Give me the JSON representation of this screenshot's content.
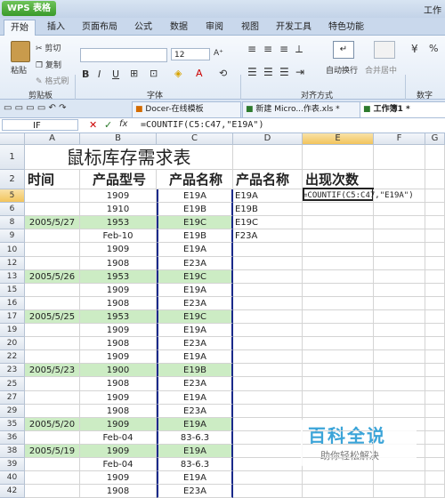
{
  "app": {
    "title": "WPS 表格",
    "window_hint": "工作"
  },
  "menu_tabs": [
    "开始",
    "插入",
    "页面布局",
    "公式",
    "数据",
    "审阅",
    "视图",
    "开发工具",
    "特色功能"
  ],
  "ribbon": {
    "clipboard": {
      "paste": "粘贴",
      "cut": "剪切",
      "copy": "复制",
      "format_painter": "格式刷",
      "group": "剪贴板"
    },
    "font": {
      "font_name": "",
      "font_size": "12",
      "bold": "B",
      "italic": "I",
      "underline": "U",
      "group": "字体"
    },
    "alignment": {
      "wrap": "自动换行",
      "merge": "合并居中",
      "group": "对齐方式"
    },
    "number": {
      "percent": "%",
      "group": "数字"
    }
  },
  "doc_tabs": [
    "Docer-在线模板",
    "新建 Micro...作表.xls *",
    "工作簿1 *"
  ],
  "formula_bar": {
    "cell_ref": "IF",
    "formula": "=COUNTIF(C5:C47,\"E19A\")"
  },
  "columns": [
    "A",
    "B",
    "C",
    "D",
    "E",
    "F",
    "G"
  ],
  "sheet": {
    "title": "鼠标库存需求表",
    "headers": {
      "a": "时间",
      "b": "产品型号",
      "c": "产品名称",
      "d": "产品名称",
      "e": "出现次数"
    },
    "rows": [
      {
        "n": "5",
        "a": "",
        "b": "1909",
        "c": "E19A",
        "d": "E19A",
        "e": "=COUNTIF(C5:C47,\"E19A\")",
        "g": false
      },
      {
        "n": "6",
        "a": "",
        "b": "1910",
        "c": "E19B",
        "d": "E19B",
        "e": "",
        "g": false
      },
      {
        "n": "8",
        "a": "2005/5/27",
        "b": "1953",
        "c": "E19C",
        "d": "E19C",
        "e": "",
        "g": true
      },
      {
        "n": "9",
        "a": "",
        "b": "Feb-10",
        "c": "E19B",
        "d": "F23A",
        "e": "",
        "g": false
      },
      {
        "n": "10",
        "a": "",
        "b": "1909",
        "c": "E19A",
        "d": "",
        "e": "",
        "g": false
      },
      {
        "n": "12",
        "a": "",
        "b": "1908",
        "c": "E23A",
        "d": "",
        "e": "",
        "g": false
      },
      {
        "n": "13",
        "a": "2005/5/26",
        "b": "1953",
        "c": "E19C",
        "d": "",
        "e": "",
        "g": true
      },
      {
        "n": "15",
        "a": "",
        "b": "1909",
        "c": "E19A",
        "d": "",
        "e": "",
        "g": false
      },
      {
        "n": "16",
        "a": "",
        "b": "1908",
        "c": "E23A",
        "d": "",
        "e": "",
        "g": false
      },
      {
        "n": "17",
        "a": "2005/5/25",
        "b": "1953",
        "c": "E19C",
        "d": "",
        "e": "",
        "g": true
      },
      {
        "n": "19",
        "a": "",
        "b": "1909",
        "c": "E19A",
        "d": "",
        "e": "",
        "g": false
      },
      {
        "n": "20",
        "a": "",
        "b": "1908",
        "c": "E23A",
        "d": "",
        "e": "",
        "g": false
      },
      {
        "n": "22",
        "a": "",
        "b": "1909",
        "c": "E19A",
        "d": "",
        "e": "",
        "g": false
      },
      {
        "n": "23",
        "a": "2005/5/23",
        "b": "1900",
        "c": "E19B",
        "d": "",
        "e": "",
        "g": true
      },
      {
        "n": "25",
        "a": "",
        "b": "1908",
        "c": "E23A",
        "d": "",
        "e": "",
        "g": false
      },
      {
        "n": "27",
        "a": "",
        "b": "1909",
        "c": "E19A",
        "d": "",
        "e": "",
        "g": false
      },
      {
        "n": "29",
        "a": "",
        "b": "1908",
        "c": "E23A",
        "d": "",
        "e": "",
        "g": false
      },
      {
        "n": "35",
        "a": "2005/5/20",
        "b": "1909",
        "c": "E19A",
        "d": "",
        "e": "",
        "g": true
      },
      {
        "n": "36",
        "a": "",
        "b": "Feb-04",
        "c": "83-6.3",
        "d": "",
        "e": "",
        "g": false
      },
      {
        "n": "38",
        "a": "2005/5/19",
        "b": "1909",
        "c": "E19A",
        "d": "",
        "e": "",
        "g": true
      },
      {
        "n": "39",
        "a": "",
        "b": "Feb-04",
        "c": "83-6.3",
        "d": "",
        "e": "",
        "g": false
      },
      {
        "n": "40",
        "a": "",
        "b": "1909",
        "c": "E19A",
        "d": "",
        "e": "",
        "g": false
      },
      {
        "n": "42",
        "a": "",
        "b": "1908",
        "c": "E23A",
        "d": "",
        "e": "",
        "g": false
      }
    ]
  },
  "watermark": {
    "line1": "百科全说",
    "line2": "助你轻松解决"
  },
  "colors": {
    "green_fill": "#ccecc4",
    "wps_green": "#3a9a2a",
    "ribbon_blue": "#c9d8ec"
  }
}
